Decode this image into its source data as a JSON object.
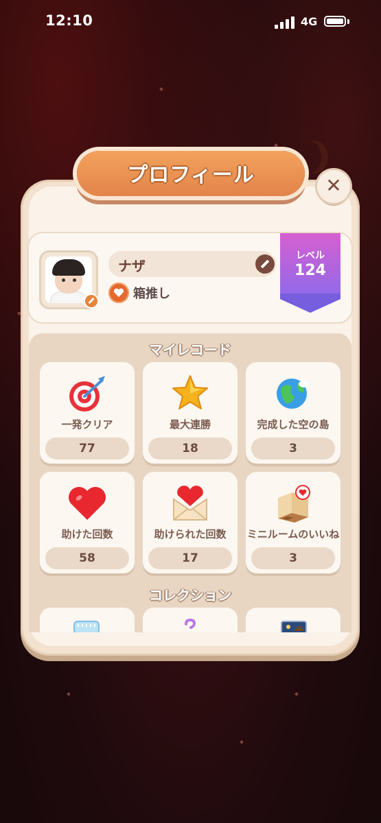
{
  "status_bar": {
    "time": "12:10",
    "network": "4G"
  },
  "dialog": {
    "title": "プロフィール",
    "close_label": "✕"
  },
  "profile": {
    "name": "ナザ",
    "favorite_label": "箱推し",
    "level_label": "レベル",
    "level_value": "124"
  },
  "records": {
    "section_title": "マイレコード",
    "items": [
      {
        "label": "一発クリア",
        "value": "77",
        "icon": "target-icon"
      },
      {
        "label": "最大連勝",
        "value": "18",
        "icon": "star-icon"
      },
      {
        "label": "完成した空の島",
        "value": "3",
        "icon": "globe-icon"
      },
      {
        "label": "助けた回数",
        "value": "58",
        "icon": "heart-icon"
      },
      {
        "label": "助けられた回数",
        "value": "17",
        "icon": "love-letter-icon"
      },
      {
        "label": "ミニルームのいいね",
        "value": "3",
        "icon": "mini-room-icon"
      }
    ]
  },
  "collection": {
    "section_title": "コレクション"
  },
  "colors": {
    "title_orange": "#e2844b",
    "level_purple": "#9b62e8",
    "panel_cream": "#fbf3ea",
    "text_brown": "#6b3f34"
  }
}
